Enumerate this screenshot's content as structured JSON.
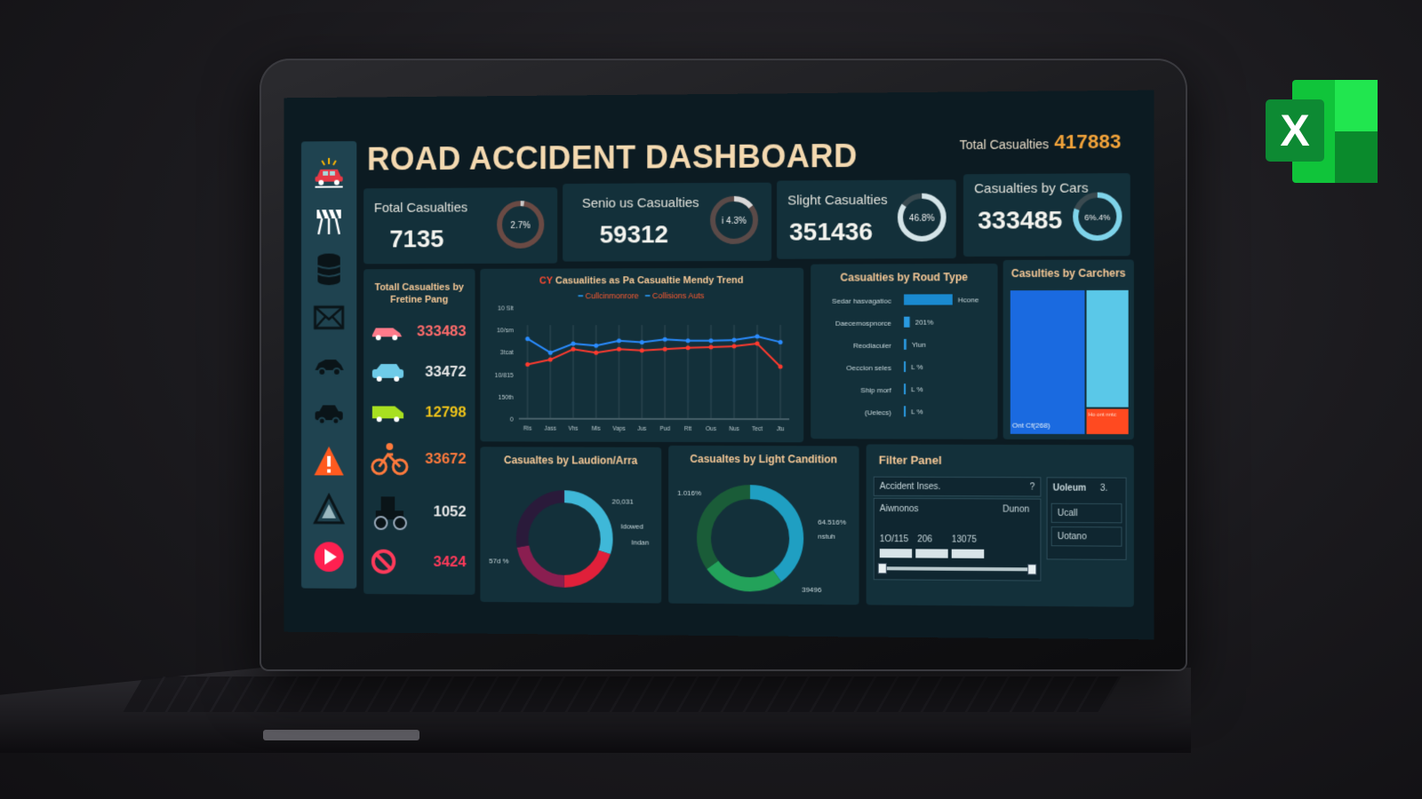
{
  "dashboard": {
    "title": "ROAD ACCIDENT DASHBOARD",
    "total_label": "Total Casualties",
    "total_value": "417883"
  },
  "kpis": [
    {
      "label": "Fotal Casualties",
      "value": "7135",
      "pct": "2.7%",
      "fraction": 0.027
    },
    {
      "label": "Senio us Casualties",
      "value": "59312",
      "pct": "i 4.3%",
      "fraction": 0.143
    },
    {
      "label": "Slight Casualties",
      "value": "351436",
      "pct": "46.8%",
      "fraction": 0.84
    },
    {
      "label": "Casualties by Cars",
      "value": "333485",
      "pct": "6%.4%",
      "fraction": 0.8
    }
  ],
  "vehicle_panel": {
    "title_line1": "Totall Casualties by",
    "title_line2": "Fretine Pang",
    "rows": [
      {
        "icon": "car-icon",
        "value": "333483",
        "color": "#ff6b6b"
      },
      {
        "icon": "suv-icon",
        "value": "33472",
        "color": "#e8e8e8"
      },
      {
        "icon": "van-icon",
        "value": "12798",
        "color": "#f0c419"
      },
      {
        "icon": "bicycle-icon",
        "value": "33672",
        "color": "#ff7a3c"
      },
      {
        "icon": "tractor-icon",
        "value": "1052",
        "color": "#e8e8e8"
      },
      {
        "icon": "no-entry-icon",
        "value": "3424",
        "color": "#ff3a5a"
      }
    ]
  },
  "sidebar": {
    "icons": [
      "crash-icon",
      "roadblock-icon",
      "database-icon",
      "mail-icon",
      "car-icon",
      "car-side-icon",
      "warning-icon",
      "triangle-icon",
      "play-icon"
    ]
  },
  "trend": {
    "title_prefix": "CY",
    "title": "Casualities as Pa Casualtie Mendy Trend",
    "legend": [
      "Cullcinmonrore",
      "Collisions Auts"
    ],
    "legend_colors": [
      "#2aa0ff",
      "#ff4030"
    ]
  },
  "chart_data": [
    {
      "type": "line",
      "y_tick_labels": [
        "0",
        "150th",
        "10/815",
        "3tcat",
        "10/sm",
        "10 Slt"
      ],
      "x": [
        "Ris",
        "Jass",
        "Vhs",
        "Mis",
        "Vaps",
        "Jus",
        "Pud",
        "Rtt",
        "Ous",
        "Nus",
        "Tect",
        "Jtu"
      ],
      "series": [
        {
          "name": "Cullcinmonrore",
          "values": [
            115,
            95,
            108,
            105,
            112,
            110,
            114,
            112,
            112,
            113,
            118,
            110
          ],
          "color": "#2a8cff"
        },
        {
          "name": "Collisions Auts",
          "values": [
            78,
            85,
            100,
            95,
            100,
            98,
            100,
            102,
            103,
            104,
            108,
            75
          ],
          "color": "#ff3a2e"
        }
      ],
      "ylim": [
        0,
        160
      ]
    },
    {
      "type": "bar",
      "title": "Casualties  by Roud Type",
      "categories": [
        "Sedar hasvagatioc",
        "Daecemospnorce",
        "Reodiacuier",
        "Oeccion seles",
        "Ship morf",
        "(Uelecs)"
      ],
      "values": [
        100,
        12,
        5,
        2,
        2,
        2
      ],
      "bar_labels": [
        "Hcone",
        "201%",
        "Yiun",
        "L %",
        "L %",
        "L %"
      ]
    },
    {
      "type": "bar",
      "title": "Casulties  by Carchers",
      "categories": [
        "Ont Cf(268)",
        "Ho ont nntc"
      ],
      "values": [
        100,
        100
      ]
    },
    {
      "type": "pie",
      "title": "Casualtes by Laudion/Arra",
      "labels": [
        "20,031",
        "Idowed",
        "Indan",
        "57d %"
      ],
      "values": [
        30,
        20,
        22,
        28
      ],
      "colors": [
        "#3fb8d8",
        "#e0203a",
        "#8a1e50",
        "#2a1a3a"
      ]
    },
    {
      "type": "pie",
      "title": "Casualtes by Light Candition",
      "labels": [
        "1.016%",
        "64.516%",
        "nstuh",
        "39496"
      ],
      "values": [
        40,
        25,
        35
      ],
      "colors": [
        "#1f9fc2",
        "#23a25a",
        "#1a5c38"
      ]
    }
  ],
  "filter_panel": {
    "title": "Filter Panel",
    "field1_label": "Accident Inses.",
    "field1_icon": "?",
    "field2_label": "Aiwnonos",
    "field2_value": "Dunon",
    "range_labels": [
      "1O/115",
      "206",
      "13075"
    ],
    "side_label": "Uoleum",
    "side_value": "3.",
    "options": [
      "Ucall",
      "Uotano"
    ]
  },
  "excel_logo": {
    "letter": "X"
  }
}
